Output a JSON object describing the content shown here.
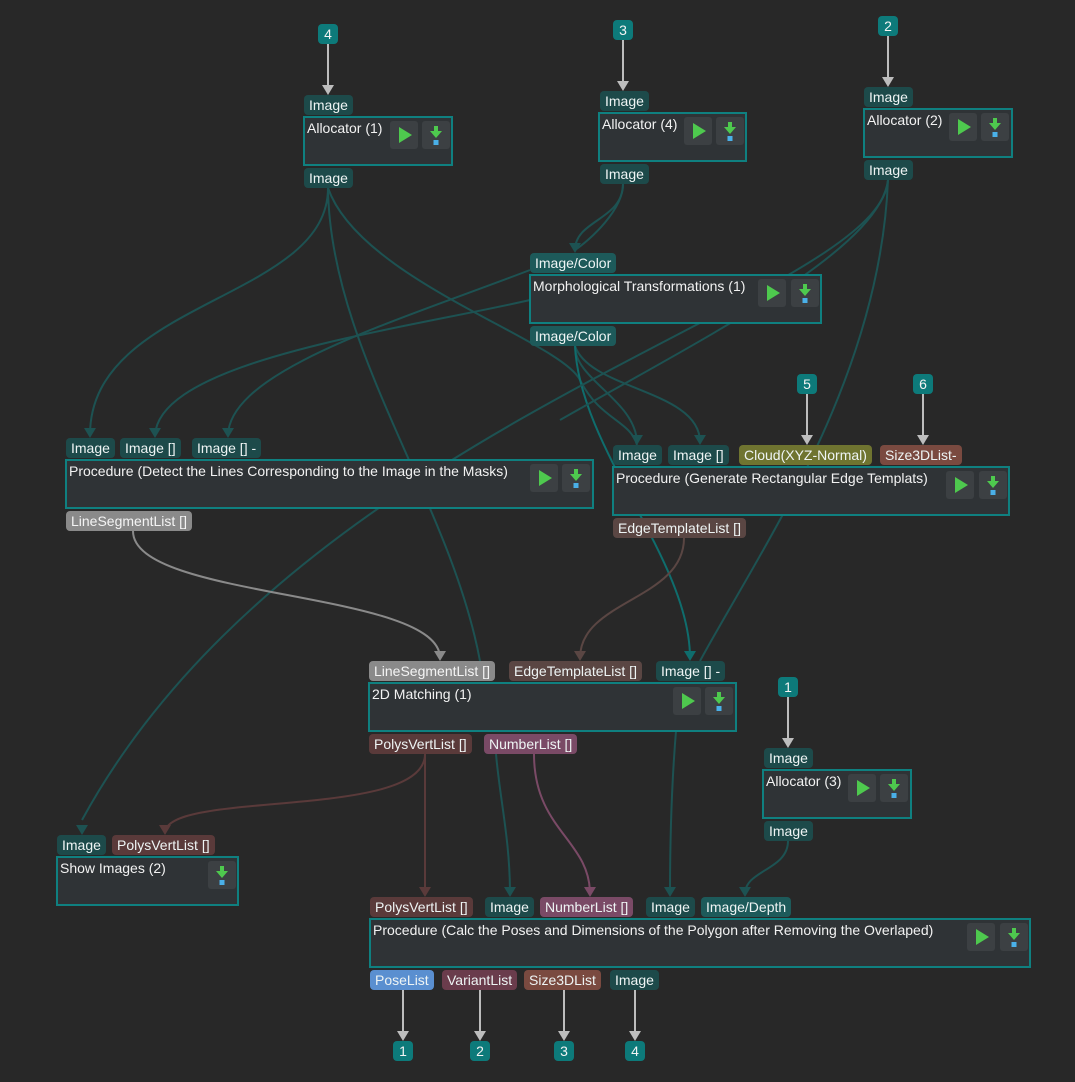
{
  "colors": {
    "background": "#282828",
    "node_border": "#0f8080",
    "node_fill": "#2f3336",
    "badge": "#0d7a7a",
    "wire_image": "#1d5252",
    "wire_line": "#8a8a8a",
    "wire_edge": "#5a4643",
    "wire_poly": "#5a3a3a",
    "wire_num": "#7a4a66",
    "wire_io": "#bdbdbd",
    "run_icon": "#4ec94e",
    "download_arrow": "#4ec94e",
    "download_base": "#4ab0e8"
  },
  "input_badges": [
    {
      "id": "in4",
      "label": "4"
    },
    {
      "id": "in3",
      "label": "3"
    },
    {
      "id": "in2",
      "label": "2"
    },
    {
      "id": "in5",
      "label": "5"
    },
    {
      "id": "in6",
      "label": "6"
    },
    {
      "id": "in1",
      "label": "1"
    }
  ],
  "output_badges": [
    {
      "id": "out1",
      "label": "1"
    },
    {
      "id": "out2",
      "label": "2"
    },
    {
      "id": "out3",
      "label": "3"
    },
    {
      "id": "out4",
      "label": "4"
    }
  ],
  "nodes": {
    "allocator1": {
      "title": "Allocator (1)",
      "inputs": [
        "Image"
      ],
      "outputs": [
        "Image"
      ]
    },
    "allocator4": {
      "title": "Allocator (4)",
      "inputs": [
        "Image"
      ],
      "outputs": [
        "Image"
      ]
    },
    "allocator2": {
      "title": "Allocator (2)",
      "inputs": [
        "Image"
      ],
      "outputs": [
        "Image"
      ]
    },
    "morph": {
      "title": "Morphological Transformations (1)",
      "inputs": [
        "Image/Color"
      ],
      "outputs": [
        "Image/Color"
      ]
    },
    "detect": {
      "title": "Procedure (Detect the Lines Corresponding to the Image in the Masks)",
      "inputs": [
        "Image",
        "Image []",
        "Image [] -"
      ],
      "outputs": [
        "LineSegmentList []"
      ]
    },
    "generate": {
      "title": "Procedure (Generate Rectangular Edge Templats)",
      "inputs": [
        "Image",
        "Image []",
        "Cloud(XYZ-Normal)",
        "Size3DList-"
      ],
      "outputs": [
        "EdgeTemplateList []"
      ]
    },
    "matching": {
      "title": "2D Matching (1)",
      "inputs": [
        "LineSegmentList []",
        "EdgeTemplateList []",
        "Image [] -"
      ],
      "outputs": [
        "PolysVertList []",
        "NumberList []"
      ]
    },
    "allocator3": {
      "title": "Allocator (3)",
      "inputs": [
        "Image"
      ],
      "outputs": [
        "Image"
      ]
    },
    "show": {
      "title": "Show Images (2)",
      "inputs": [
        "Image",
        "PolysVertList []"
      ],
      "outputs": []
    },
    "calc": {
      "title": "Procedure (Calc the Poses and  Dimensions of the Polygon after Removing the Overlaped)",
      "inputs": [
        "PolysVertList []",
        "Image",
        "NumberList []",
        "Image",
        "Image/Depth"
      ],
      "outputs": [
        "PoseList",
        "VariantList",
        "Size3DList",
        "Image"
      ]
    }
  },
  "icons": {
    "run": "play-triangle",
    "download": "down-arrow-with-bar"
  }
}
